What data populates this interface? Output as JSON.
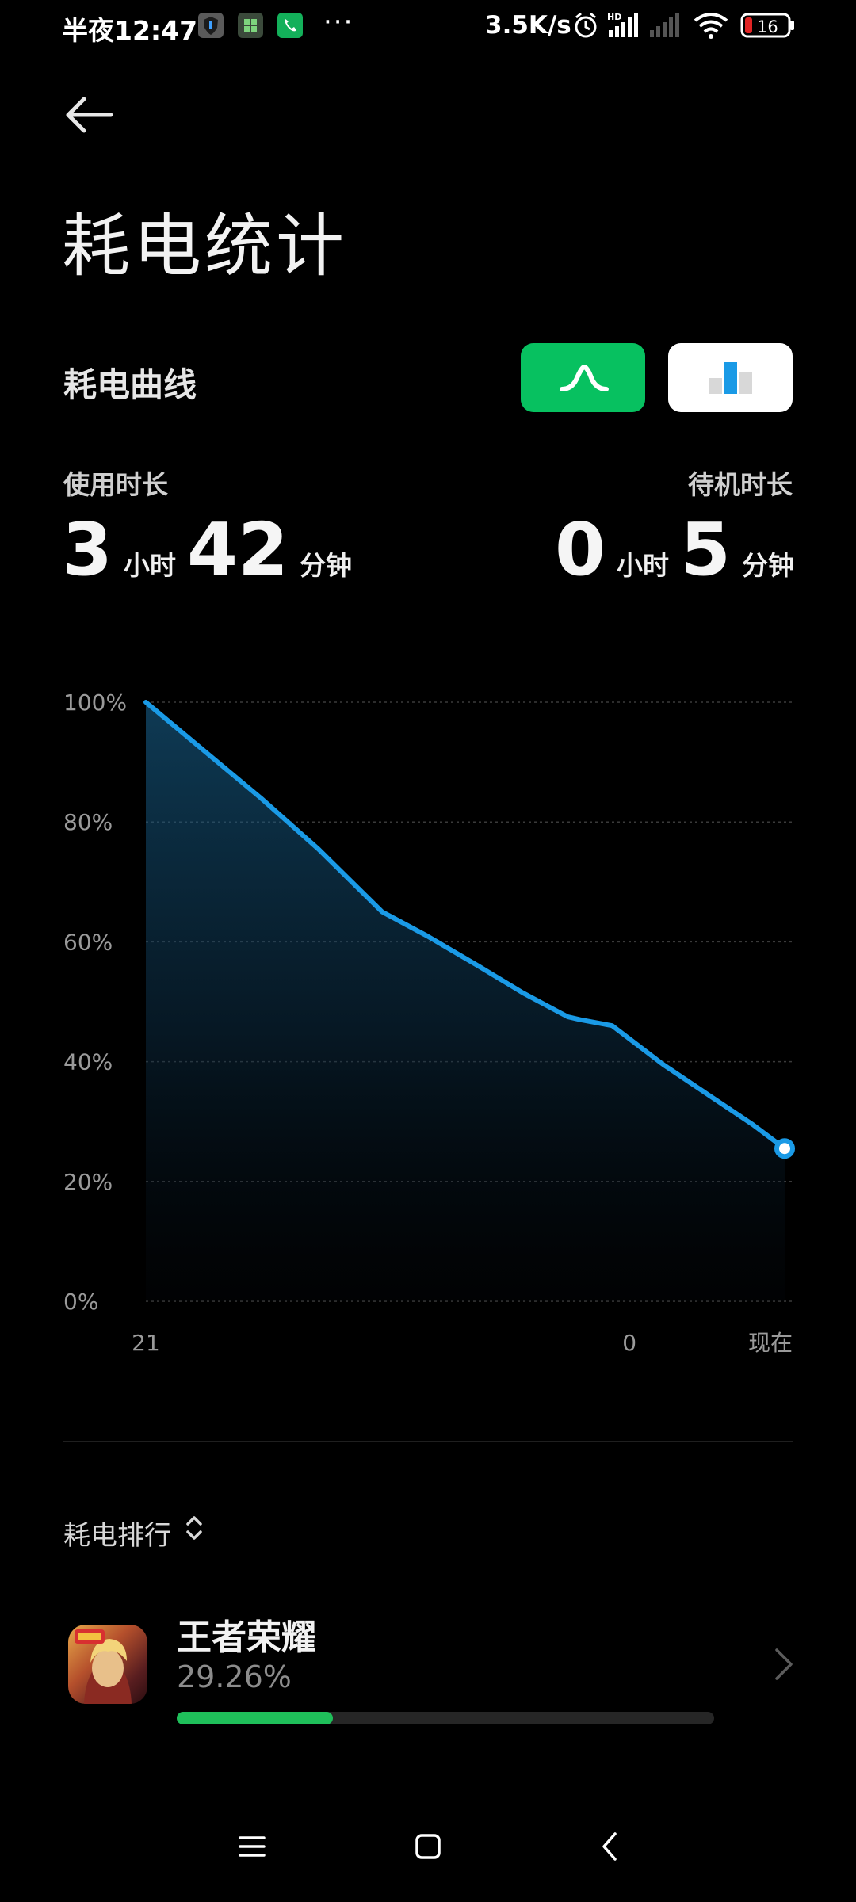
{
  "status": {
    "time": "半夜12:47",
    "dots": "···",
    "net_speed": "3.5K/s",
    "hd_label": "HD",
    "battery_level": "16"
  },
  "header": {
    "back_icon": "arrow-left-icon",
    "title": "耗电统计"
  },
  "curve_section": {
    "title": "耗电曲线",
    "toggle_line_icon": "line-chart-icon",
    "toggle_bar_icon": "bar-chart-icon",
    "active_color": "#07c160"
  },
  "usage": {
    "label": "使用时长",
    "hours": "3",
    "hour_unit": "小时",
    "minutes": "42",
    "minute_unit": "分钟"
  },
  "standby": {
    "label": "待机时长",
    "hours": "0",
    "hour_unit": "小时",
    "minutes": "5",
    "minute_unit": "分钟"
  },
  "chart_data": {
    "type": "area",
    "ytick_labels": [
      "100%",
      "80%",
      "60%",
      "40%",
      "20%",
      "0%"
    ],
    "ylim": [
      0,
      100
    ],
    "xtick_labels": [
      "21",
      "0",
      "现在"
    ],
    "xlim": [
      0,
      1
    ],
    "xtick_positions": [
      0,
      0.757,
      1
    ],
    "series": [
      {
        "x": [
          0,
          0.09,
          0.18,
          0.27,
          0.37,
          0.44,
          0.52,
          0.59,
          0.66,
          0.68,
          0.73,
          0.81,
          0.88,
          0.95,
          1.0
        ],
        "values": [
          100,
          92,
          84,
          75.5,
          65,
          61,
          56,
          51.5,
          47.5,
          47,
          46,
          39.5,
          34.5,
          29.5,
          25.5
        ]
      }
    ],
    "line_color": "#1a9ae6",
    "grid": true
  },
  "ranking": {
    "title": "耗电排行",
    "sort_icon": "sort-updown-icon",
    "apps": [
      {
        "name": "王者荣耀",
        "percent": "29.26%",
        "fraction": 0.29,
        "icon": "game-app-icon"
      }
    ]
  },
  "navbar": {
    "menu_icon": "menu-icon",
    "home_icon": "home-square-icon",
    "back_icon": "back-chevron-icon"
  }
}
